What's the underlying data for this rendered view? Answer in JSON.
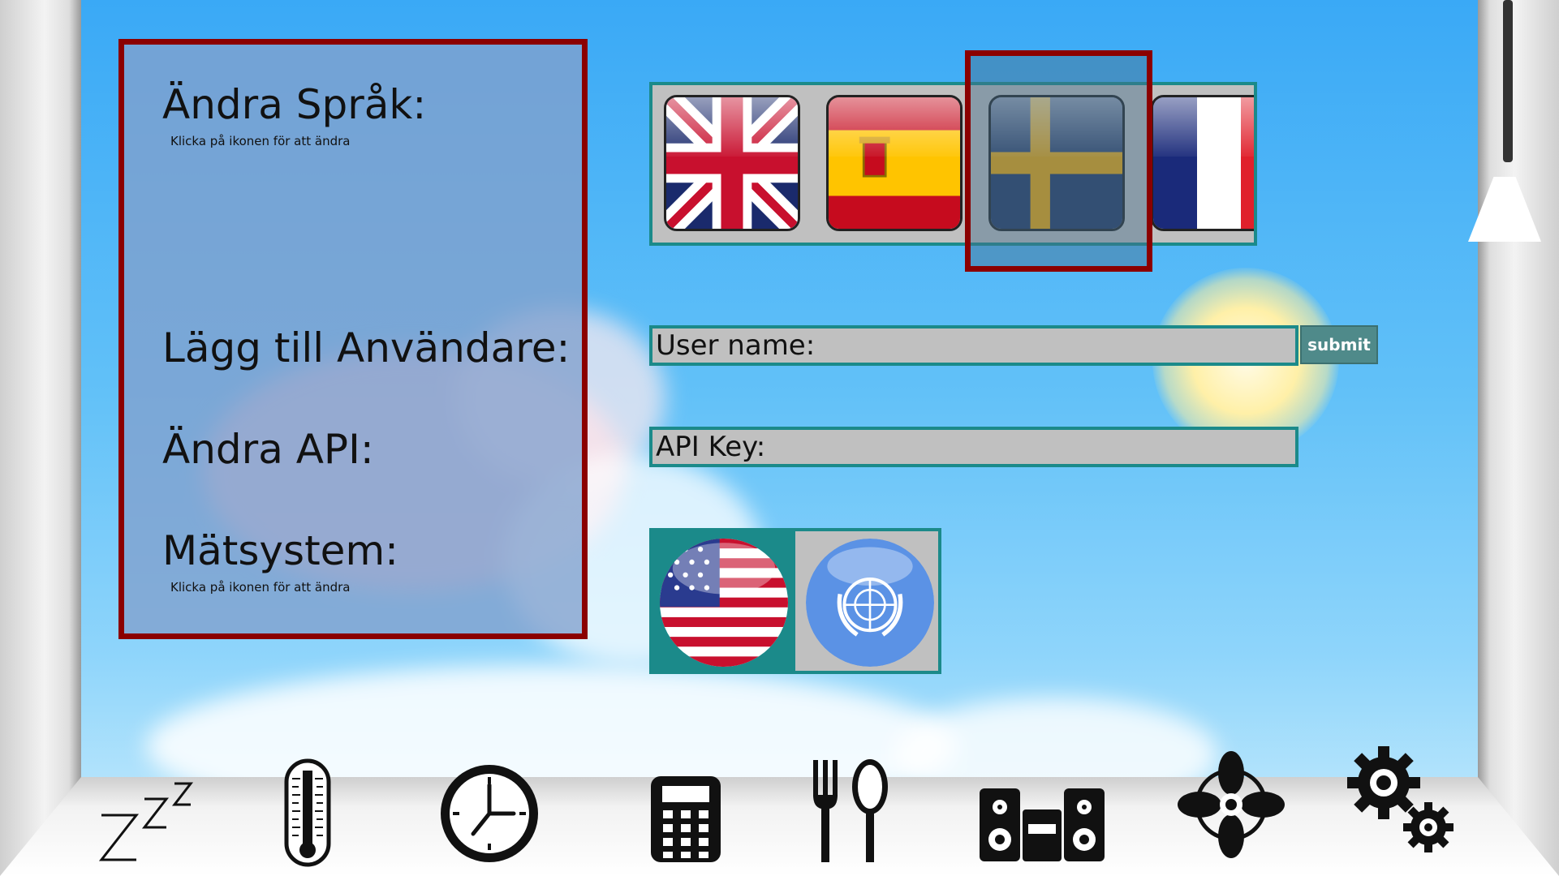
{
  "settings": {
    "language": {
      "heading": "Ändra Språk:",
      "hint": "Klicka på ikonen för att ändra"
    },
    "add_user": {
      "heading": "Lägg till Användare:"
    },
    "api": {
      "heading": "Ändra API:"
    },
    "units": {
      "heading": "Mätsystem:",
      "hint": "Klicka på ikonen för att ändra"
    }
  },
  "languages": [
    {
      "name": "english",
      "icon": "uk-flag-icon"
    },
    {
      "name": "spanish",
      "icon": "spain-flag-icon"
    },
    {
      "name": "swedish",
      "icon": "sweden-flag-icon",
      "selected": true
    },
    {
      "name": "french",
      "icon": "france-flag-icon"
    }
  ],
  "user_form": {
    "label": "User name:",
    "submit_label": "submit"
  },
  "api_form": {
    "label": "API Key:"
  },
  "unit_systems": [
    {
      "name": "imperial",
      "icon": "usa-flag-icon",
      "selected": true
    },
    {
      "name": "metric",
      "icon": "un-emblem-icon"
    }
  ],
  "dock": [
    "sleep-icon",
    "thermometer-icon",
    "clock-icon",
    "calculator-icon",
    "food-icon",
    "stereo-icon",
    "fan-icon",
    "settings-icon"
  ],
  "colors": {
    "accent_border": "#8b0000",
    "tray_border": "#1b8a8a",
    "field_bg": "#c0c0c0"
  }
}
